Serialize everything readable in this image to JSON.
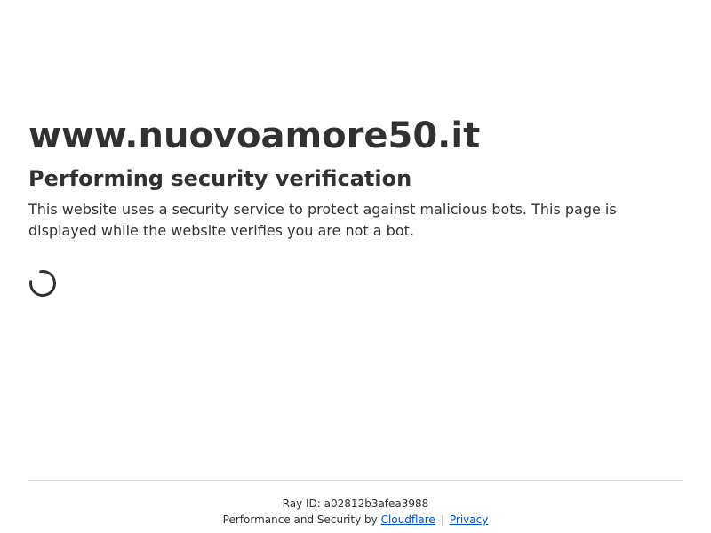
{
  "site": {
    "domain": "www.nuovoamore50.it"
  },
  "verification": {
    "heading": "Performing security verification",
    "description": "This website uses a security service to protect against malicious bots. This page is displayed while the website verifies you are not a bot.",
    "spinner_icon": "loading-spinner-icon"
  },
  "footer": {
    "ray_label": "Ray ID:",
    "ray_id": "a02812b3afea3988",
    "perf_text": "Performance and Security by",
    "cloudflare_link": "Cloudflare",
    "separator": "|",
    "privacy_link": "Privacy",
    "link_color": "#0051c3"
  }
}
